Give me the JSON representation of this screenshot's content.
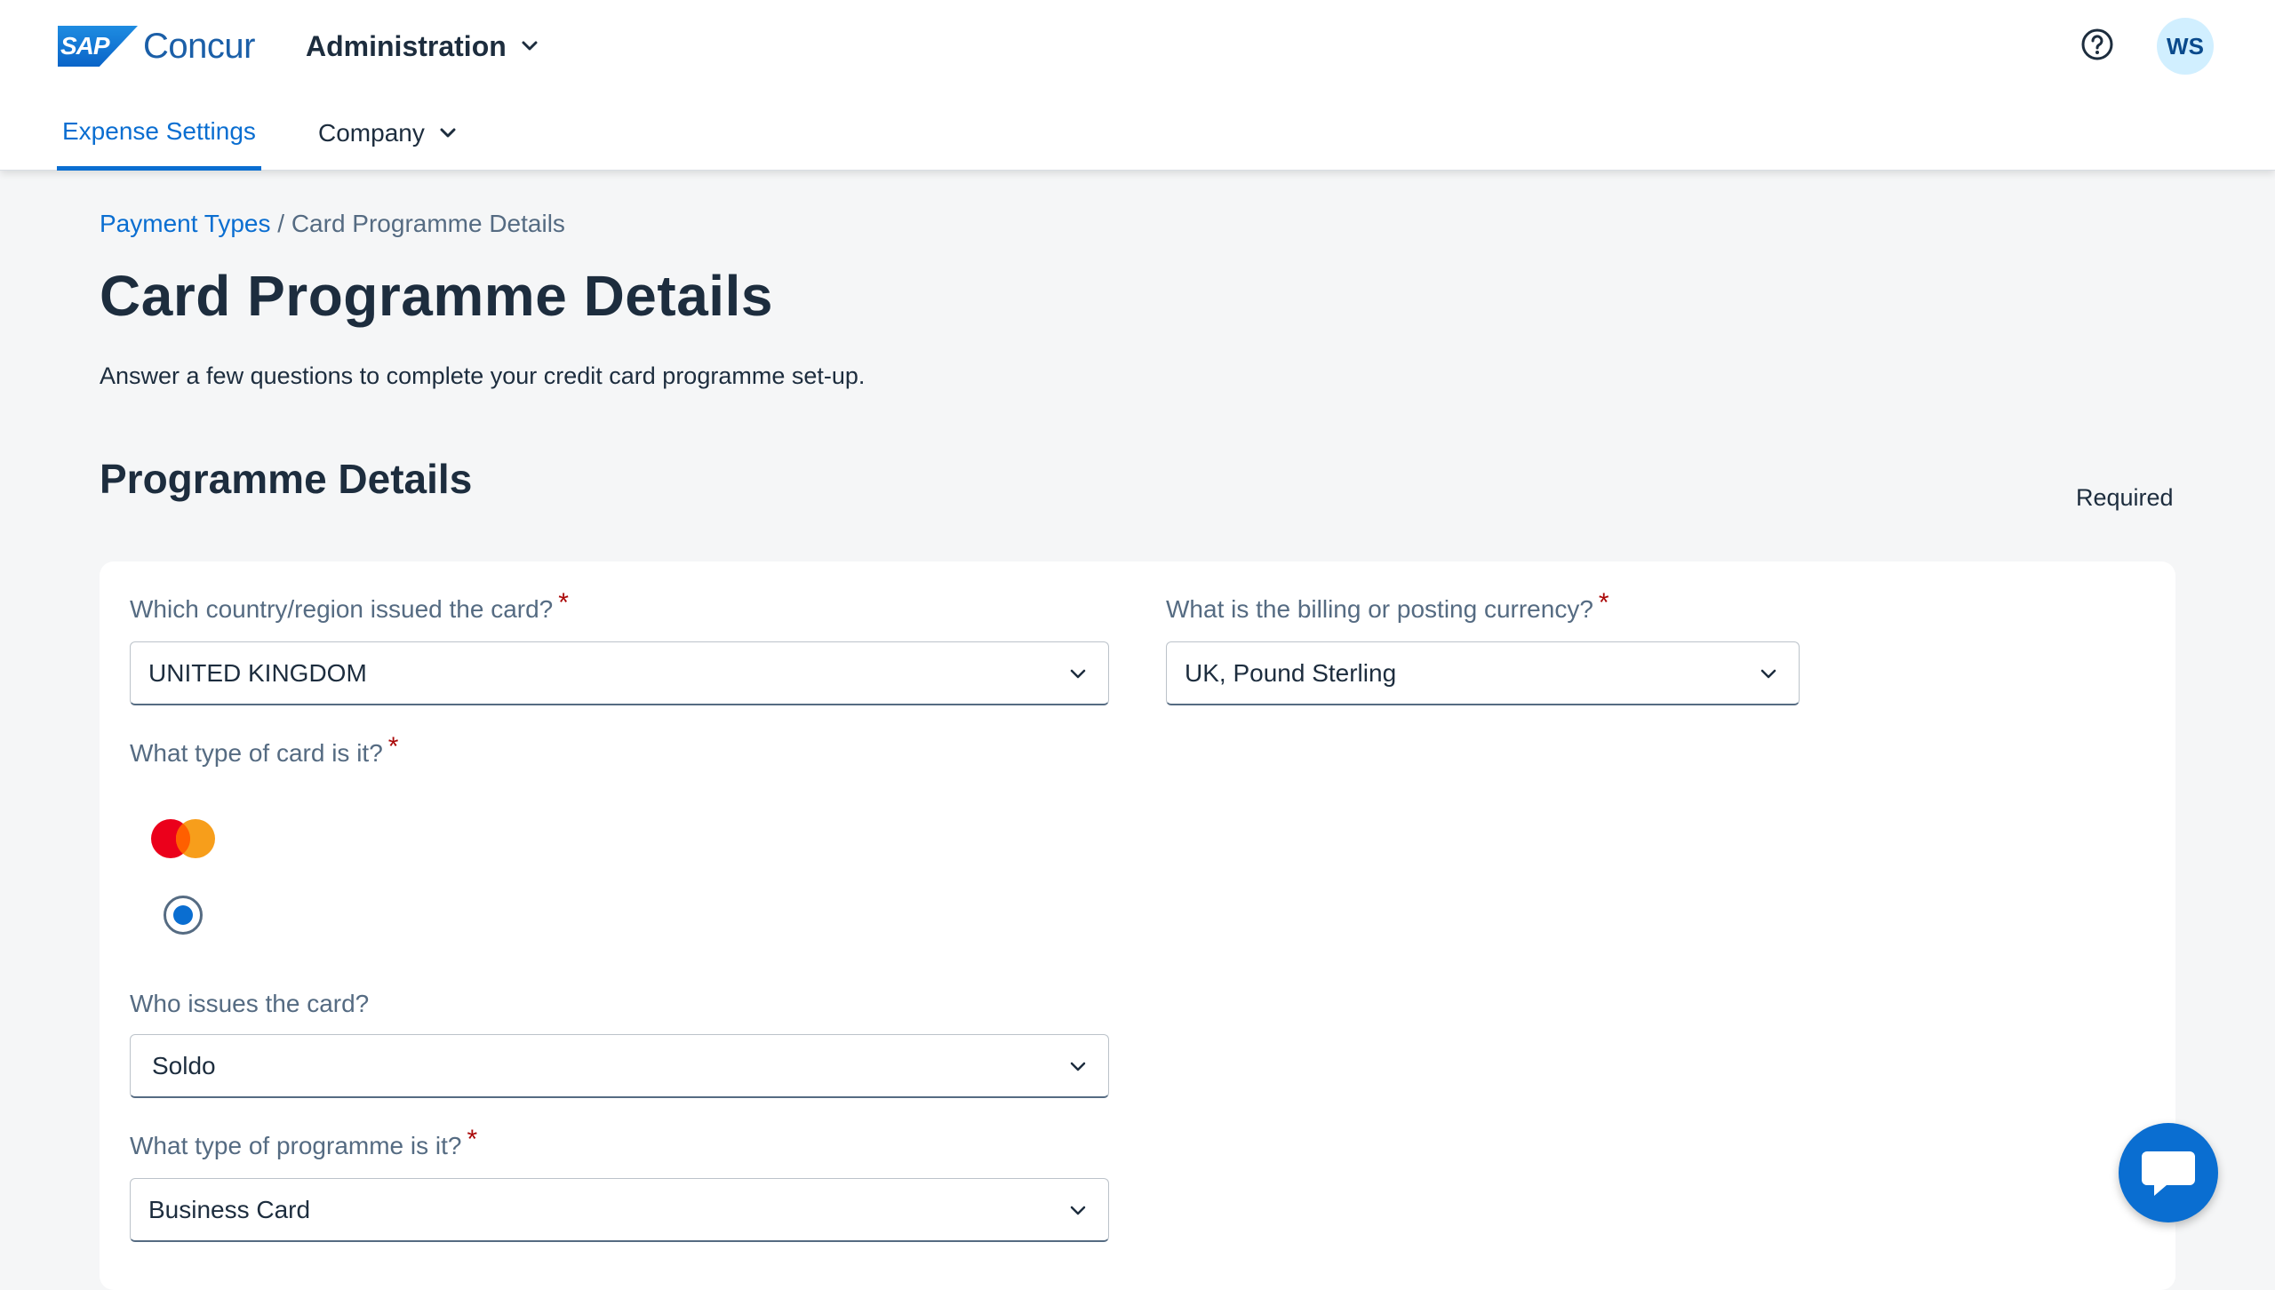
{
  "header": {
    "brand_sap": "SAP",
    "brand_name": "Concur",
    "admin_menu_label": "Administration",
    "avatar_initials": "WS",
    "tabs": [
      {
        "label": "Expense Settings",
        "active": true
      },
      {
        "label": "Company",
        "active": false
      }
    ]
  },
  "breadcrumb": {
    "parent": "Payment Types",
    "separator": " / ",
    "current": "Card Programme Details"
  },
  "page": {
    "title": "Card Programme Details",
    "intro": "Answer a few questions to complete your credit card programme set-up.",
    "section_title": "Programme Details",
    "required_note": "Required"
  },
  "form": {
    "country": {
      "label": "Which country/region issued the card?",
      "required_mark": "*",
      "value": "UNITED KINGDOM"
    },
    "currency": {
      "label": "What is the billing or posting currency?",
      "required_mark": "*",
      "value": "UK, Pound Sterling"
    },
    "card_type": {
      "label": "What type of card is it?",
      "required_mark": "*",
      "selected": "mastercard-icon"
    },
    "issuer": {
      "label": "Who issues the card?",
      "value": "Soldo"
    },
    "programme_type": {
      "label": "What type of programme is it?",
      "required_mark": "*",
      "value": "Business Card"
    }
  },
  "colors": {
    "accent": "#0a6ed1",
    "required": "#aa0808",
    "mastercard_red": "#eb001b",
    "mastercard_orange": "#f79e1b"
  }
}
